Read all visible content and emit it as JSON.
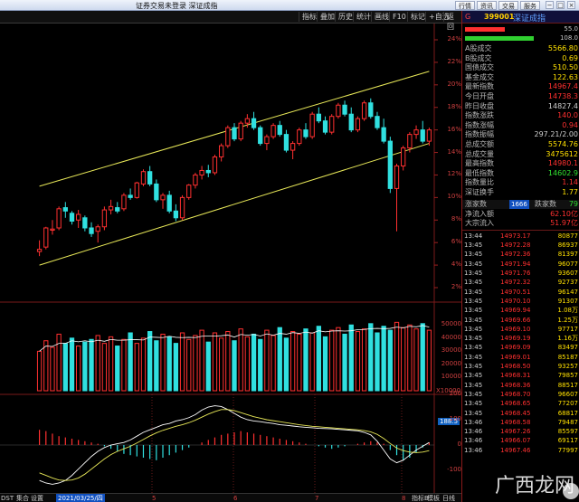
{
  "window": {
    "title": "证券交易未登录  深证成指",
    "buttons": [
      "行情",
      "资讯",
      "交易",
      "服务"
    ],
    "controls": [
      "−",
      "□",
      "×"
    ]
  },
  "toolbar": {
    "items": [
      "指标",
      "叠加",
      "历史",
      "统计",
      "画线",
      "F10",
      "标记",
      "+自选",
      "返回"
    ]
  },
  "price_axis": [
    "24%",
    "22%",
    "20%",
    "18%",
    "16%",
    "14%",
    "12%",
    "10%",
    "8%",
    "6%",
    "4%",
    "2%"
  ],
  "volume_axis": [
    "50000",
    "40000",
    "30000",
    "20000",
    "10000"
  ],
  "volume_unit": "X10000",
  "macd_axis_label": "188.5",
  "macd_axis": [
    "200",
    "100",
    "0",
    "-100"
  ],
  "bottom": {
    "left": "DST",
    "tabs": [
      "集合",
      "设置"
    ],
    "date": "2021/03/25/四",
    "date_ticks": [
      "5",
      "6",
      "7",
      "8"
    ],
    "right": [
      "指标B",
      "模板"
    ],
    "corner": "日线"
  },
  "colors": {
    "up": "#ff3030",
    "down": "#30e0e0",
    "line": "#e8e858",
    "accent": "#ffe000"
  },
  "chart_data": {
    "type": "candlestick",
    "candles": [
      [
        5.2,
        6.2,
        4.8,
        5.4
      ],
      [
        5.6,
        7.4,
        5.4,
        7.3
      ],
      [
        7.1,
        8.0,
        6.7,
        7.2
      ],
      [
        7.3,
        9.2,
        7.1,
        9.0
      ],
      [
        9.1,
        9.6,
        8.2,
        8.8
      ],
      [
        8.6,
        8.8,
        7.6,
        7.9
      ],
      [
        8.0,
        8.9,
        7.3,
        8.5
      ],
      [
        8.2,
        8.4,
        7.0,
        7.3
      ],
      [
        7.3,
        7.8,
        6.5,
        6.8
      ],
      [
        7.0,
        7.6,
        6.0,
        7.4
      ],
      [
        7.4,
        9.2,
        7.1,
        8.9
      ],
      [
        8.9,
        9.8,
        8.5,
        9.2
      ],
      [
        9.1,
        9.6,
        8.6,
        8.8
      ],
      [
        9.0,
        10.4,
        8.8,
        10.2
      ],
      [
        10.2,
        10.8,
        9.8,
        10.0
      ],
      [
        10.0,
        11.4,
        9.9,
        11.3
      ],
      [
        11.2,
        12.5,
        11.0,
        12.3
      ],
      [
        12.3,
        12.8,
        11.0,
        11.2
      ],
      [
        11.2,
        11.6,
        9.6,
        9.8
      ],
      [
        9.8,
        10.4,
        9.0,
        10.2
      ],
      [
        10.2,
        10.6,
        8.6,
        8.8
      ],
      [
        8.8,
        9.4,
        7.9,
        8.2
      ],
      [
        8.2,
        10.2,
        8.0,
        10.0
      ],
      [
        10.0,
        11.2,
        9.8,
        11.1
      ],
      [
        11.1,
        12.2,
        10.8,
        12.0
      ],
      [
        12.0,
        12.8,
        11.6,
        12.4
      ],
      [
        12.4,
        12.9,
        11.8,
        12.2
      ],
      [
        12.2,
        13.8,
        12.0,
        13.6
      ],
      [
        13.6,
        14.8,
        13.2,
        14.6
      ],
      [
        14.6,
        16.4,
        14.4,
        16.2
      ],
      [
        16.2,
        16.6,
        15.0,
        15.2
      ],
      [
        15.2,
        16.8,
        15.0,
        16.6
      ],
      [
        16.6,
        17.4,
        16.2,
        17.0
      ],
      [
        17.0,
        17.6,
        16.0,
        16.2
      ],
      [
        16.2,
        16.4,
        14.6,
        14.8
      ],
      [
        14.8,
        15.6,
        14.2,
        15.4
      ],
      [
        15.4,
        16.6,
        15.2,
        16.4
      ],
      [
        16.4,
        16.8,
        15.4,
        15.6
      ],
      [
        15.6,
        16.0,
        14.0,
        14.2
      ],
      [
        14.2,
        15.0,
        13.4,
        14.8
      ],
      [
        14.8,
        16.2,
        14.6,
        16.0
      ],
      [
        16.0,
        16.6,
        15.2,
        15.4
      ],
      [
        15.4,
        17.6,
        15.2,
        17.4
      ],
      [
        17.4,
        18.0,
        16.6,
        16.8
      ],
      [
        16.8,
        17.2,
        15.6,
        15.8
      ],
      [
        15.8,
        17.4,
        15.6,
        17.2
      ],
      [
        17.2,
        18.4,
        17.0,
        18.2
      ],
      [
        18.2,
        18.6,
        17.2,
        17.4
      ],
      [
        17.4,
        18.0,
        15.8,
        16.0
      ],
      [
        16.0,
        17.2,
        15.8,
        17.0
      ],
      [
        17.0,
        18.6,
        16.8,
        18.4
      ],
      [
        18.4,
        18.8,
        17.0,
        17.2
      ],
      [
        17.2,
        17.6,
        16.0,
        16.2
      ],
      [
        16.2,
        17.0,
        14.8,
        15.0
      ],
      [
        15.0,
        15.4,
        10.4,
        10.8
      ],
      [
        10.8,
        13.0,
        7.0,
        12.8
      ],
      [
        12.8,
        14.6,
        12.4,
        14.4
      ],
      [
        14.4,
        15.8,
        14.0,
        15.6
      ],
      [
        15.6,
        16.4,
        15.2,
        16.0
      ],
      [
        16.0,
        16.8,
        14.8,
        15.0
      ],
      [
        15.0,
        16.2,
        14.6,
        16.0
      ]
    ],
    "channel_upper": [
      [
        1,
        11.0
      ],
      [
        61,
        21.2
      ]
    ],
    "channel_lower": [
      [
        1,
        4.0
      ],
      [
        61,
        14.8
      ]
    ],
    "volume": [
      30,
      38,
      33,
      43,
      36,
      40,
      34,
      37,
      39,
      42,
      36,
      41,
      34,
      39,
      44,
      36,
      40,
      45,
      38,
      43,
      41,
      36,
      44,
      39,
      42,
      46,
      37,
      44,
      40,
      45,
      38,
      47,
      41,
      43,
      39,
      46,
      42,
      48,
      40,
      45,
      43,
      47,
      44,
      49,
      41,
      46,
      48,
      43,
      50,
      45,
      47,
      51,
      44,
      49,
      46,
      52,
      48,
      50,
      47,
      51,
      46
    ],
    "macd_hist": [
      60,
      55,
      45,
      35,
      30,
      25,
      20,
      15,
      10,
      5,
      -5,
      -15,
      -25,
      -35,
      -40,
      -45,
      -50,
      -55,
      -60,
      -50,
      -40,
      -30,
      -20,
      -10,
      0,
      10,
      20,
      30,
      40,
      45,
      50,
      55,
      50,
      45,
      40,
      35,
      30,
      25,
      20,
      15,
      10,
      5,
      0,
      -5,
      -10,
      -15,
      -10,
      -5,
      0,
      5,
      10,
      15,
      10,
      5,
      -20,
      -40,
      -60,
      -50,
      -30,
      -10,
      10
    ],
    "dif": [
      -140,
      -150,
      -155,
      -150,
      -140,
      -120,
      -95,
      -70,
      -45,
      -25,
      -10,
      0,
      5,
      10,
      20,
      35,
      50,
      60,
      70,
      80,
      85,
      95,
      100,
      108,
      120,
      138,
      150,
      155,
      152,
      140,
      125,
      110,
      100,
      95,
      92,
      88,
      85,
      80,
      78,
      75,
      72,
      70,
      68,
      66,
      65,
      64,
      62,
      60,
      58,
      56,
      50,
      40,
      15,
      -20,
      -55,
      -70,
      -60,
      -40,
      -20,
      -5,
      10
    ],
    "dea": [
      -110,
      -120,
      -130,
      -138,
      -140,
      -138,
      -130,
      -115,
      -95,
      -75,
      -55,
      -38,
      -25,
      -15,
      -5,
      8,
      22,
      36,
      48,
      58,
      66,
      74,
      80,
      88,
      98,
      110,
      122,
      132,
      140,
      140,
      136,
      128,
      120,
      112,
      106,
      100,
      96,
      92,
      88,
      84,
      80,
      77,
      74,
      72,
      70,
      68,
      66,
      64,
      62,
      60,
      57,
      52,
      42,
      26,
      6,
      -12,
      -22,
      -28,
      -30,
      -28,
      -22
    ]
  },
  "right_panel": {
    "header": {
      "g": "G",
      "code": "399001",
      "name": "深证成指"
    },
    "bars": [
      {
        "color": "#ff3030",
        "value": "55.0",
        "pct": 0.55
      },
      {
        "color": "#30d030",
        "value": "108.0",
        "pct": 0.95
      }
    ],
    "stats": [
      {
        "k": "A股成交",
        "v": "5566.80",
        "c": "#ffe000"
      },
      {
        "k": "B股成交",
        "v": "0.69",
        "c": "#ffe000"
      },
      {
        "k": "国债成交",
        "v": "510.50",
        "c": "#ffe000"
      },
      {
        "k": "基金成交",
        "v": "122.63",
        "c": "#ffe000"
      },
      {
        "k": "最新指数",
        "v": "14967.4",
        "c": "#ff3030"
      },
      {
        "k": "今日开盘",
        "v": "14738.3",
        "c": "#ff3030"
      },
      {
        "k": "昨日收盘",
        "v": "14827.4",
        "c": "#d0d0d0"
      },
      {
        "k": "指数涨跌",
        "v": "140.0",
        "c": "#ff3030"
      },
      {
        "k": "指数涨幅",
        "v": "0.94",
        "c": "#ff3030"
      },
      {
        "k": "指数振幅",
        "v": "297.21/2.00",
        "c": "#d0d0d0"
      },
      {
        "k": "总成交额",
        "v": "5574.76",
        "c": "#ffe000"
      },
      {
        "k": "总成交量",
        "v": "3475612",
        "c": "#ffe000"
      },
      {
        "k": "最高指数",
        "v": "14980.1",
        "c": "#ff3030"
      },
      {
        "k": "最低指数",
        "v": "14602.9",
        "c": "#30e030"
      },
      {
        "k": "指数量比",
        "v": "1.14",
        "c": "#ff3030"
      },
      {
        "k": "深证换手",
        "v": "1.77",
        "c": "#ffe000"
      }
    ],
    "updown": {
      "up_label": "涨家数",
      "up_val": "1666",
      "down_label": "跌家数",
      "down_val": "79"
    },
    "flows": [
      {
        "k": "净流入额",
        "v": "62.10亿",
        "c": "#ff3030"
      },
      {
        "k": "大宗流入",
        "v": "51.97亿",
        "c": "#ff3030"
      }
    ],
    "ticks": [
      {
        "t": "13:44",
        "p": "14973.17",
        "q": "80877"
      },
      {
        "t": "13:45",
        "p": "14972.28",
        "q": "86937"
      },
      {
        "t": "13:45",
        "p": "14972.36",
        "q": "81397"
      },
      {
        "t": "13:45",
        "p": "14971.94",
        "q": "96077"
      },
      {
        "t": "13:45",
        "p": "14971.76",
        "q": "93607"
      },
      {
        "t": "13:45",
        "p": "14972.32",
        "q": "92737"
      },
      {
        "t": "13:45",
        "p": "14970.51",
        "q": "96147"
      },
      {
        "t": "13:45",
        "p": "14970.10",
        "q": "91307"
      },
      {
        "t": "13:45",
        "p": "14969.94",
        "q": "1.08万"
      },
      {
        "t": "13:45",
        "p": "14969.66",
        "q": "1.25万"
      },
      {
        "t": "13:45",
        "p": "14969.10",
        "q": "97717"
      },
      {
        "t": "13:45",
        "p": "14969.19",
        "q": "1.16万"
      },
      {
        "t": "13:45",
        "p": "14969.09",
        "q": "83497"
      },
      {
        "t": "13:45",
        "p": "14969.01",
        "q": "85187"
      },
      {
        "t": "13:45",
        "p": "14968.50",
        "q": "93257"
      },
      {
        "t": "13:45",
        "p": "14968.31",
        "q": "79857"
      },
      {
        "t": "13:45",
        "p": "14968.36",
        "q": "88517"
      },
      {
        "t": "13:45",
        "p": "14968.70",
        "q": "96607"
      },
      {
        "t": "13:45",
        "p": "14968.65",
        "q": "77207"
      },
      {
        "t": "13:45",
        "p": "14968.45",
        "q": "68817"
      },
      {
        "t": "13:46",
        "p": "14968.58",
        "q": "79487"
      },
      {
        "t": "13:46",
        "p": "14967.26",
        "q": "85597"
      },
      {
        "t": "13:46",
        "p": "14966.07",
        "q": "69117"
      },
      {
        "t": "13:46",
        "p": "14967.46",
        "q": "77997"
      }
    ]
  },
  "watermark": "广西龙网"
}
